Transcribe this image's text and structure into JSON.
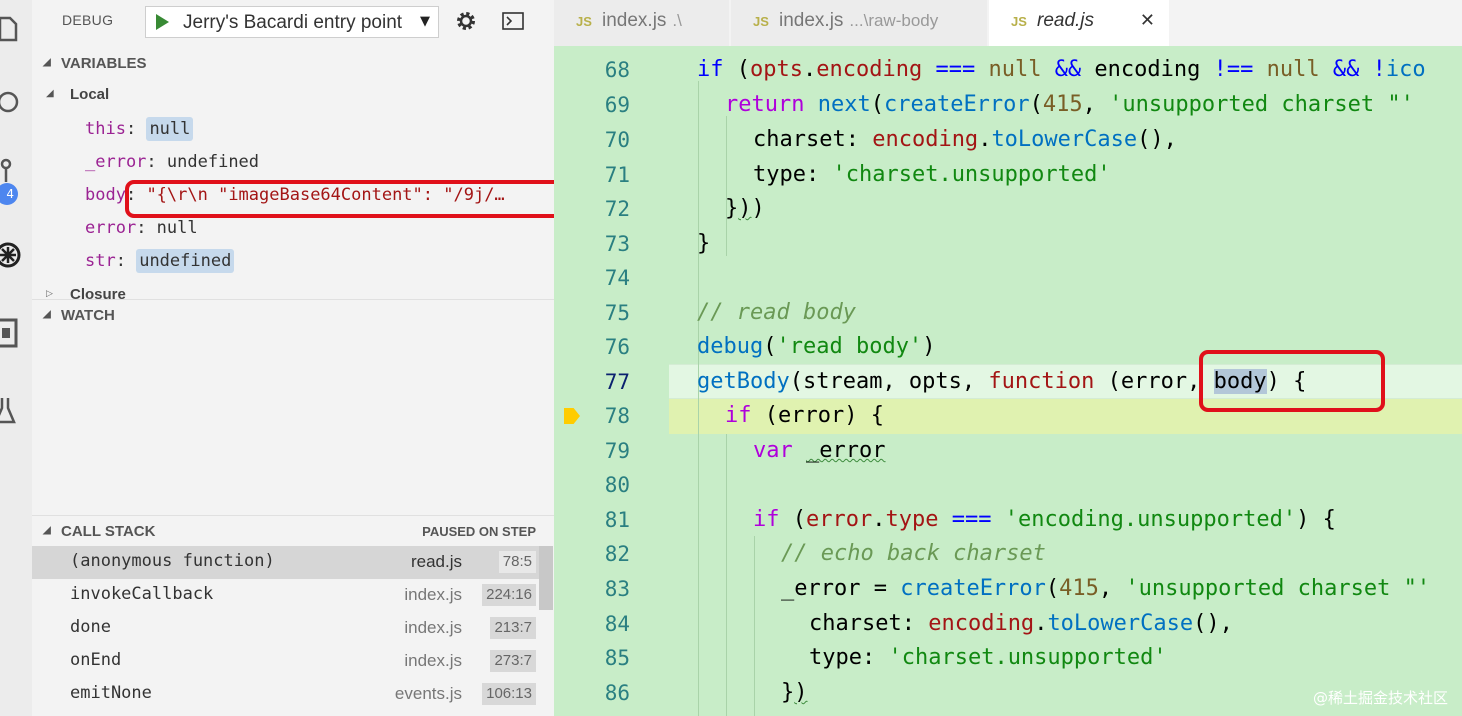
{
  "activity_badge": "4",
  "debug_toolbar": {
    "title": "DEBUG",
    "config_name": "Jerry's Bacardi entry point",
    "caret": "▼"
  },
  "variables": {
    "header": "VARIABLES",
    "local_label": "Local",
    "items": [
      {
        "name": "this",
        "value": "null"
      },
      {
        "name": "_error",
        "value": "undefined"
      },
      {
        "name": "body",
        "value": "\"{\\r\\n   \"imageBase64Content\": \"/9j/…"
      },
      {
        "name": "error",
        "value": "null"
      },
      {
        "name": "str",
        "value": "undefined"
      }
    ],
    "closure_label": "Closure"
  },
  "watch": {
    "header": "WATCH"
  },
  "call_stack": {
    "header": "CALL STACK",
    "status": "PAUSED ON STEP",
    "frames": [
      {
        "name": "(anonymous function)",
        "file": "read.js",
        "pos": "78:5"
      },
      {
        "name": "invokeCallback",
        "file": "index.js",
        "pos": "224:16"
      },
      {
        "name": "done",
        "file": "index.js",
        "pos": "213:7"
      },
      {
        "name": "onEnd",
        "file": "index.js",
        "pos": "273:7"
      },
      {
        "name": "emitNone",
        "file": "events.js",
        "pos": "106:13"
      }
    ]
  },
  "tabs": [
    {
      "icon": "JS",
      "name": "index.js",
      "path": ".\\"
    },
    {
      "icon": "JS",
      "name": "index.js",
      "path": "...\\raw-body"
    },
    {
      "icon": "JS",
      "name": "read.js",
      "path": "",
      "close": "✕"
    }
  ],
  "editor": {
    "line_numbers": [
      "68",
      "69",
      "70",
      "71",
      "72",
      "73",
      "74",
      "75",
      "76",
      "77",
      "78",
      "79",
      "80",
      "81",
      "82",
      "83",
      "84",
      "85",
      "86"
    ],
    "current_line": "77",
    "paused_line": "78"
  },
  "watermark": "@稀土掘金技术社区"
}
